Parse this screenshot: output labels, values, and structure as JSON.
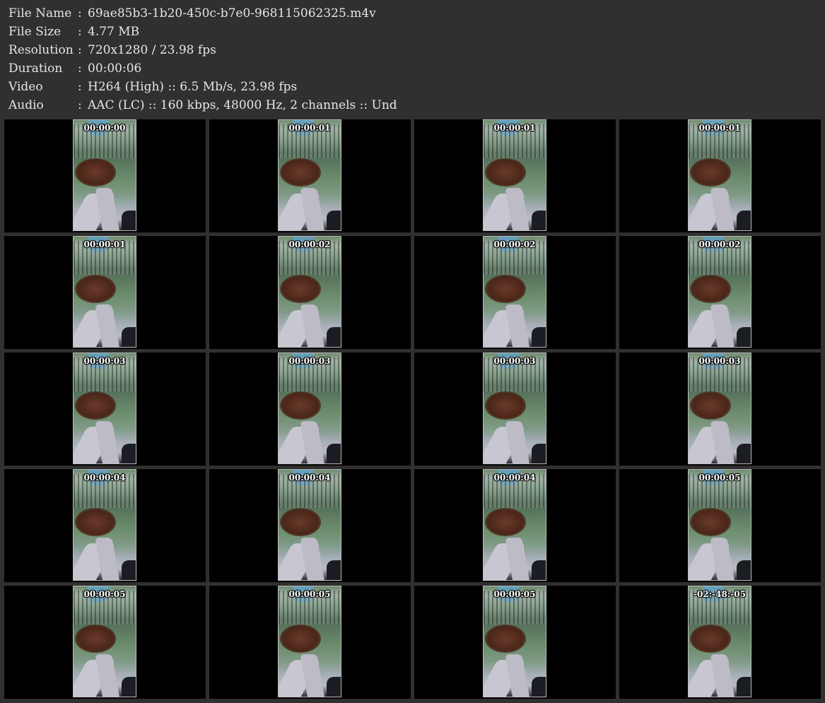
{
  "info": [
    {
      "label": "File Name",
      "sep": ":",
      "value": "69ae85b3-1b20-450c-b7e0-968115062325.m4v"
    },
    {
      "label": "File Size",
      "sep": ":",
      "value": "4.77 MB"
    },
    {
      "label": "Resolution",
      "sep": ":",
      "value": "720x1280 / 23.98 fps"
    },
    {
      "label": "Duration",
      "sep": ":",
      "value": "00:00:06"
    },
    {
      "label": "Video",
      "sep": ":",
      "value": "H264 (High) :: 6.5 Mb/s, 23.98 fps"
    },
    {
      "label": "Audio",
      "sep": ":",
      "value": "AAC (LC) :: 160 kbps, 48000 Hz, 2 channels :: Und"
    }
  ],
  "thumbnails": [
    "00:00:00",
    "00:00:01",
    "00:00:01",
    "00:00:01",
    "00:00:01",
    "00:00:02",
    "00:00:02",
    "00:00:02",
    "00:00:03",
    "00:00:03",
    "00:00:03",
    "00:00:03",
    "00:00:04",
    "00:00:04",
    "00:00:04",
    "00:00:05",
    "00:00:05",
    "00:00:05",
    "00:00:05",
    "-02:-48:-05"
  ],
  "colors": {
    "background": "#303030",
    "cell_background": "#000000",
    "text": "#e6e6e6",
    "timestamp": "#ffffff"
  }
}
